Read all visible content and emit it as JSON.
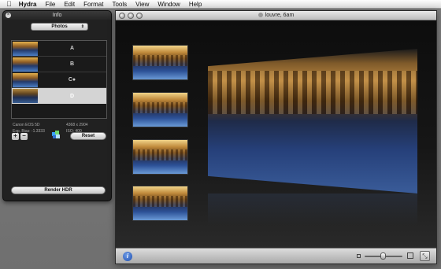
{
  "menubar": {
    "apple_icon": "apple-icon",
    "items": [
      "Hydra",
      "File",
      "Edit",
      "Format",
      "Tools",
      "View",
      "Window",
      "Help"
    ]
  },
  "info_panel": {
    "title": "Info",
    "select_value": "Photos",
    "layers": [
      {
        "label": "A",
        "selected": false
      },
      {
        "label": "B",
        "selected": false
      },
      {
        "label": "C●",
        "selected": false
      },
      {
        "label": "D",
        "selected": true
      }
    ],
    "camera": "Canon EOS 5D",
    "exposure": "Exp. Bias: -1.3333",
    "resolution": "4368 x 2904",
    "iso": "ISO: 400",
    "add_label": "+",
    "remove_label": "−",
    "reset_label": "Reset",
    "render_label": "Render HDR"
  },
  "window": {
    "title": "louvre, 6am",
    "thumbnails": 4,
    "fullscreen_glyph": "⤡",
    "info_glyph": "i",
    "zoom_level": 0.42
  }
}
